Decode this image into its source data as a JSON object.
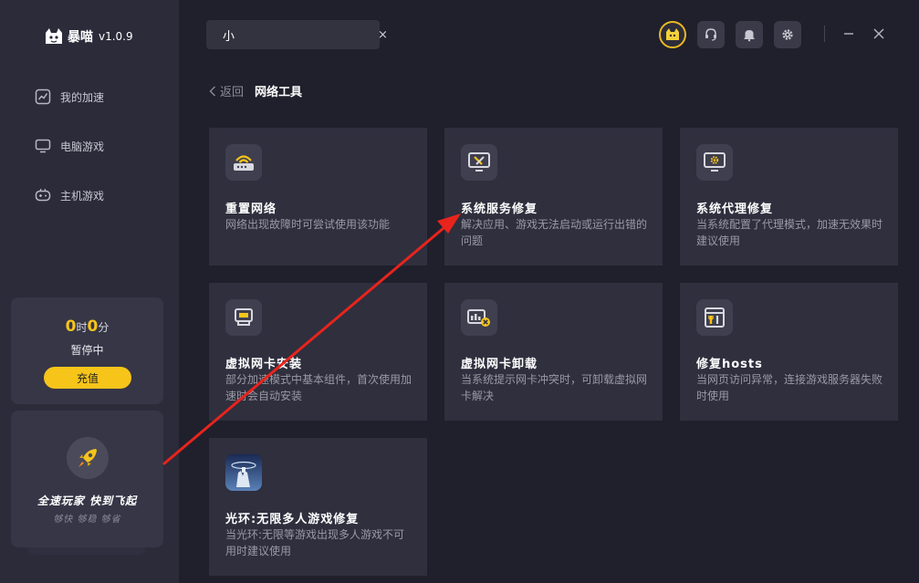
{
  "app": {
    "name": "暴喵",
    "version": "v1.0.9"
  },
  "sidebar": {
    "items": [
      {
        "label": "我的加速",
        "icon": "chart-icon"
      },
      {
        "label": "电脑游戏",
        "icon": "monitor-icon"
      },
      {
        "label": "主机游戏",
        "icon": "gamepad-icon"
      }
    ],
    "time": {
      "hours": "0",
      "hour_unit": "时",
      "minutes": "0",
      "minute_unit": "分",
      "status": "暂停中",
      "recharge_label": "充值"
    },
    "promo": {
      "title": "全速玩家 快到飞起",
      "subtitle": "够快 够稳 够省"
    }
  },
  "search": {
    "value": "小",
    "placeholder": ""
  },
  "breadcrumb": {
    "back_label": "返回",
    "title": "网络工具"
  },
  "tools": [
    {
      "title": "重置网络",
      "desc": "网络出现故障时可尝试使用该功能",
      "icon": "router-icon"
    },
    {
      "title": "系统服务修复",
      "desc": "解决应用、游戏无法启动或运行出错的问题",
      "icon": "monitor-tools-icon"
    },
    {
      "title": "系统代理修复",
      "desc": "当系统配置了代理模式，加速无效果时建议使用",
      "icon": "monitor-gear-icon"
    },
    {
      "title": "虚拟网卡安装",
      "desc": "部分加速模式中基本组件，首次使用加速时会自动安装",
      "icon": "network-card-icon"
    },
    {
      "title": "虚拟网卡卸载",
      "desc": "当系统提示网卡冲突时，可卸载虚拟网卡解决",
      "icon": "network-card-remove-icon"
    },
    {
      "title": "修复hosts",
      "desc": "当网页访问异常，连接游戏服务器失败时使用",
      "icon": "browser-tools-icon"
    },
    {
      "title": "光环:无限多人游戏修复",
      "desc": "当光环:无限等游戏出现多人游戏不可用时建议使用",
      "icon": "halo-game-icon"
    }
  ],
  "colors": {
    "accent": "#f7c41a",
    "annotation": "#e8241c"
  }
}
